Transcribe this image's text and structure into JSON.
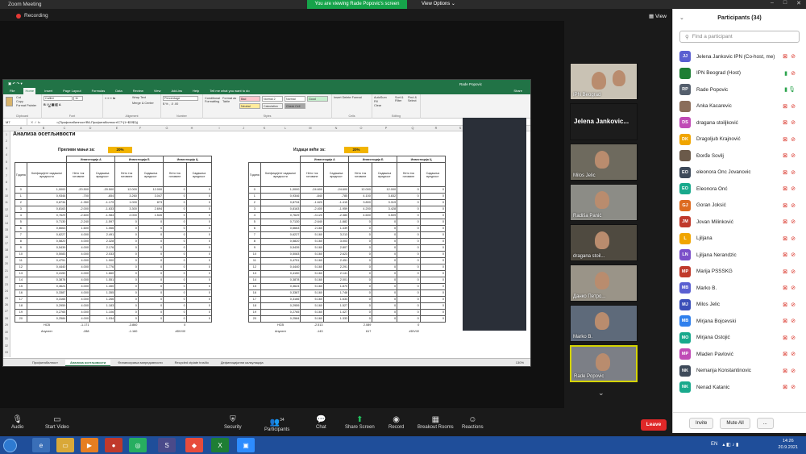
{
  "window": {
    "title": "Zoom Meeting"
  },
  "banner": {
    "text": "You are viewing Rade Popovic's screen",
    "view_options": "View Options ⌄"
  },
  "recording": {
    "label": "Recording"
  },
  "view_button": "View",
  "excel": {
    "user": "Rade Popovic",
    "tabs": [
      "File",
      "Home",
      "Insert",
      "Page Layout",
      "Formulas",
      "Data",
      "Review",
      "View",
      "Add-ins",
      "Help",
      "Tell me what you want to do"
    ],
    "share": "Share",
    "ribbon": {
      "clipboard": "Clipboard",
      "cut": "Cut",
      "copy": "Copy",
      "format_painter": "Format Painter",
      "font_name": "Calibri",
      "font_size": "11",
      "font": "Font",
      "alignment": "Alignment",
      "wrap_text": "Wrap Text",
      "merge": "Merge & Center",
      "number_format": "Percentage",
      "number": "Number",
      "cond_format": "Conditional Formatting",
      "format_table": "Format as Table",
      "styles": [
        "Bad",
        "Normal 2",
        "Normal",
        "Good",
        "Neutral",
        "Calculation",
        "Check Cell"
      ],
      "styles_label": "Styles",
      "insert": "Insert",
      "delete": "Delete",
      "format": "Format",
      "cells": "Cells",
      "autosum": "AutoSum",
      "fill": "Fill",
      "clear": "Clear",
      "sort": "Sort & Filter",
      "find": "Find & Select",
      "editing": "Editing"
    },
    "namebox": "M7",
    "formula": "=(Профитабилност!B6-Профитабилност!C7*(1+$O$3))",
    "columns": [
      "A",
      "B",
      "C",
      "D",
      "E",
      "F",
      "G",
      "H",
      "I",
      "J",
      "K",
      "L",
      "M",
      "N",
      "O",
      "P",
      "Q",
      "R",
      "S"
    ],
    "left": {
      "title": "Анализа осетљивости",
      "input_label": "Приливи мањи за:",
      "input_pct": "20%",
      "groups": [
        "Инвестиција А",
        "Инвестиција Б",
        "Инвестиција Ц"
      ],
      "headers": [
        "Година",
        "Коефицијент садашње вредности",
        "Нето ток готовине",
        "Садашња вредност",
        "Нето ток готовине",
        "Садашња вредност",
        "Нето ток готовине",
        "Садашња вредност"
      ],
      "rows": [
        [
          "0",
          "1,0000",
          "-20.500",
          "-20.500",
          "12.000",
          "12.000",
          "0",
          "0"
        ],
        [
          "1",
          "0,9346",
          "-700",
          "-654",
          "3.260",
          "3.047",
          "0",
          "0"
        ],
        [
          "2",
          "0,8734",
          "-1.350",
          "-1.179",
          "1.000",
          "873",
          "0",
          "0"
        ],
        [
          "3",
          "0,8163",
          "-2.000",
          "-1.633",
          "3.300",
          "2.694",
          "0",
          "0"
        ],
        [
          "4",
          "0,7629",
          "-2.600",
          "-1.984",
          "2.000",
          "1.526",
          "0",
          "0"
        ],
        [
          "5",
          "0,7130",
          "-2.240",
          "-1.597",
          "0",
          "0",
          "0",
          "0"
        ],
        [
          "6",
          "0,6663",
          "1.600",
          "1.066",
          "0",
          "0",
          "0",
          "0"
        ],
        [
          "7",
          "0,6227",
          "4.000",
          "2.491",
          "0",
          "0",
          "0",
          "0"
        ],
        [
          "8",
          "0,5820",
          "4.000",
          "2.328",
          "0",
          "0",
          "0",
          "0"
        ],
        [
          "9",
          "0,5439",
          "4.000",
          "2.176",
          "0",
          "0",
          "0",
          "0"
        ],
        [
          "10",
          "0,5083",
          "4.000",
          "2.033",
          "0",
          "0",
          "0",
          "0"
        ],
        [
          "11",
          "0,4751",
          "4.000",
          "1.900",
          "0",
          "0",
          "0",
          "0"
        ],
        [
          "12",
          "0,4440",
          "4.000",
          "1.776",
          "0",
          "0",
          "0",
          "0"
        ],
        [
          "13",
          "0,4150",
          "4.000",
          "1.660",
          "0",
          "0",
          "0",
          "0"
        ],
        [
          "14",
          "0,3878",
          "4.000",
          "1.551",
          "0",
          "0",
          "0",
          "0"
        ],
        [
          "15",
          "0,3624",
          "4.000",
          "1.450",
          "0",
          "0",
          "0",
          "0"
        ],
        [
          "16",
          "0,3387",
          "4.000",
          "1.355",
          "0",
          "0",
          "0",
          "0"
        ],
        [
          "17",
          "0,3166",
          "4.000",
          "1.266",
          "0",
          "0",
          "0",
          "0"
        ],
        [
          "18",
          "0,2959",
          "4.000",
          "1.183",
          "0",
          "0",
          "0",
          "0"
        ],
        [
          "19",
          "0,2765",
          "4.000",
          "1.106",
          "0",
          "0",
          "0",
          "0"
        ],
        [
          "20",
          "0,2584",
          "4.000",
          "1.034",
          "0",
          "0",
          "0",
          "0"
        ]
      ],
      "npv_label": "НСВ",
      "npv": [
        "-1.171",
        "",
        "-3.860",
        "",
        "0"
      ],
      "annuity_label": "Ануитет",
      "annuity": [
        "-288",
        "",
        "-1.160",
        "",
        "#DIV/0!"
      ]
    },
    "right": {
      "input_label": "Издаци већи за:",
      "input_pct": "20%",
      "groups": [
        "Инвестиција А",
        "Инвестиција Б",
        "Инвестиција Ц"
      ],
      "headers": [
        "Година",
        "Коефицијент садашње вредности",
        "Нето ток готовине",
        "Садашња вредност",
        "Нето ток готовине",
        "Садашња вредност",
        "Нето ток готовине",
        "Садашња вредност"
      ],
      "rows": [
        [
          "0",
          "1,0000",
          "-24.600",
          "-24.600",
          "12.000",
          "12.000",
          "0",
          "0"
        ],
        [
          "1",
          "0,9346",
          "-840",
          "-785",
          "4.100",
          "3.832",
          "0",
          "0"
        ],
        [
          "2",
          "0,8734",
          "-1.620",
          "-1.415",
          "3.800",
          "3.319",
          "0",
          "0"
        ],
        [
          "3",
          "0,8163",
          "-2.400",
          "-1.959",
          "4.200",
          "3.428",
          "0",
          "0"
        ],
        [
          "4",
          "0,7629",
          "-3.120",
          "-2.380",
          "4.600",
          "3.509",
          "0",
          "0"
        ],
        [
          "5",
          "0,7130",
          "-2.640",
          "-1.882",
          "0",
          "0",
          "0",
          "0"
        ],
        [
          "6",
          "0,6663",
          "2.160",
          "1.439",
          "0",
          "0",
          "0",
          "0"
        ],
        [
          "7",
          "0,6227",
          "5.160",
          "3.213",
          "0",
          "0",
          "0",
          "0"
        ],
        [
          "8",
          "0,5820",
          "5.160",
          "3.003",
          "0",
          "0",
          "0",
          "0"
        ],
        [
          "9",
          "0,5439",
          "5.160",
          "2.807",
          "0",
          "0",
          "0",
          "0"
        ],
        [
          "10",
          "0,5083",
          "5.160",
          "2.623",
          "0",
          "0",
          "0",
          "0"
        ],
        [
          "11",
          "0,4751",
          "5.160",
          "2.451",
          "0",
          "0",
          "0",
          "0"
        ],
        [
          "12",
          "0,4440",
          "5.160",
          "2.291",
          "0",
          "0",
          "0",
          "0"
        ],
        [
          "13",
          "0,4150",
          "5.160",
          "2.141",
          "0",
          "0",
          "0",
          "0"
        ],
        [
          "14",
          "0,3878",
          "5.160",
          "2.001",
          "0",
          "0",
          "0",
          "0"
        ],
        [
          "15",
          "0,3624",
          "5.160",
          "1.870",
          "0",
          "0",
          "0",
          "0"
        ],
        [
          "16",
          "0,3387",
          "5.160",
          "1.748",
          "0",
          "0",
          "0",
          "0"
        ],
        [
          "17",
          "0,3166",
          "5.160",
          "1.634",
          "0",
          "0",
          "0",
          "0"
        ],
        [
          "18",
          "0,2959",
          "5.160",
          "1.527",
          "0",
          "0",
          "0",
          "0"
        ],
        [
          "19",
          "0,2765",
          "5.160",
          "1.427",
          "0",
          "0",
          "0",
          "0"
        ],
        [
          "20",
          "0,2584",
          "5.160",
          "1.333",
          "0",
          "0",
          "0",
          "0"
        ]
      ],
      "npv_label": "НСВ",
      "npv": [
        "-2.513",
        "",
        "2.089",
        "",
        "0"
      ],
      "annuity_label": "Ануитет",
      "annuity": [
        "-143",
        "",
        "617",
        "",
        "#DIV/0!"
      ]
    },
    "sheet_tabs": [
      "Профитабилност",
      "Анализа осетљивости",
      "Финансирања ванредовности",
      "Recycled otpiate trosilio",
      "Дефиницијални калкулација"
    ],
    "zoom": "130%"
  },
  "video_tiles": [
    "IPN Beograd",
    "Jelena Jankovic...",
    "Milos Jelic",
    "Radiša Panić",
    "dragana stoil...",
    "Данко Петро...",
    "Marko B.",
    "Rade Popovic"
  ],
  "participants": {
    "title": "Participants (34)",
    "search_placeholder": "Find a participant",
    "list": [
      {
        "initials": "JJ",
        "name": "Jelena Jankovic IPN (Co-host, me)",
        "color": "#5a5fd1"
      },
      {
        "initials": "",
        "name": "IPN Beograd (Host)",
        "color": "#1e7e34"
      },
      {
        "initials": "RP",
        "name": "Rade Popovic",
        "color": "#555f6d"
      },
      {
        "initials": "",
        "name": "Anka Kacarevic",
        "color": "#8a6d5a"
      },
      {
        "initials": "DS",
        "name": "dragana stoiljković",
        "color": "#c04bb6"
      },
      {
        "initials": "DK",
        "name": "Dragoljub Krajnović",
        "color": "#f0a500"
      },
      {
        "initials": "",
        "name": "Đorđe Sovilj",
        "color": "#6b5a4a"
      },
      {
        "initials": "EO",
        "name": "eleonora Onc Jovanovic",
        "color": "#3e4a5a"
      },
      {
        "initials": "EO",
        "name": "Eleonora Onć",
        "color": "#18a98c"
      },
      {
        "initials": "GJ",
        "name": "Goran Joksić",
        "color": "#dd6b20"
      },
      {
        "initials": "JM",
        "name": "Jovan Milinković",
        "color": "#c0392b"
      },
      {
        "initials": "L",
        "name": "Ljiljana",
        "color": "#f0a500"
      },
      {
        "initials": "LN",
        "name": "Ljiljana Nerandzic",
        "color": "#7b4fc9"
      },
      {
        "initials": "MP",
        "name": "Marija PSSSKG",
        "color": "#c0392b"
      },
      {
        "initials": "MB",
        "name": "Marko B.",
        "color": "#5a5fd1"
      },
      {
        "initials": "MJ",
        "name": "Milos Jelic",
        "color": "#3b4fb8"
      },
      {
        "initials": "MB",
        "name": "Mirjana Bojcevski",
        "color": "#2f80ed"
      },
      {
        "initials": "MO",
        "name": "Mirjana Ostojić",
        "color": "#18a98c"
      },
      {
        "initials": "MP",
        "name": "Mladen Pavlović",
        "color": "#c04bb6"
      },
      {
        "initials": "NK",
        "name": "Nemanja Konstantinovic",
        "color": "#3e4a5a"
      },
      {
        "initials": "NK",
        "name": "Nenad Katanic",
        "color": "#18a98c"
      }
    ],
    "invite": "Invite",
    "mute_all": "Mute All",
    "more": "..."
  },
  "toolbar": {
    "audio": "Audio",
    "start_video": "Start Video",
    "security": "Security",
    "participants": "Participants",
    "participants_count": "34",
    "chat": "Chat",
    "share_screen": "Share Screen",
    "record": "Record",
    "breakout": "Breakout Rooms",
    "reactions": "Reactions",
    "leave": "Leave"
  },
  "taskbar": {
    "lang": "EN",
    "time": "14:26",
    "date": "20.9.2021"
  }
}
